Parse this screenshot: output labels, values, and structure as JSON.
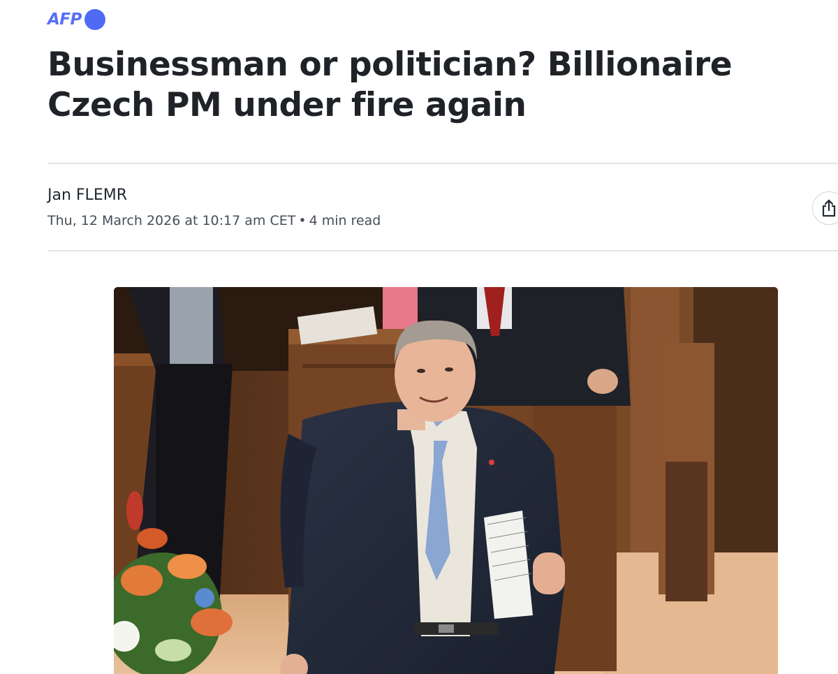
{
  "provider": {
    "logo_text": "AFP",
    "logo_color": "#5870f5"
  },
  "article": {
    "headline": "Businessman or politician? Billionaire Czech PM under fire again",
    "author": "Jan FLEMR",
    "date": "Thu, 12 March 2026 at 10:17 am CET",
    "separator": "•",
    "read_time": "4 min read"
  },
  "share": {
    "icon": "share-icon"
  },
  "hero_image": {
    "subject": "photo"
  }
}
